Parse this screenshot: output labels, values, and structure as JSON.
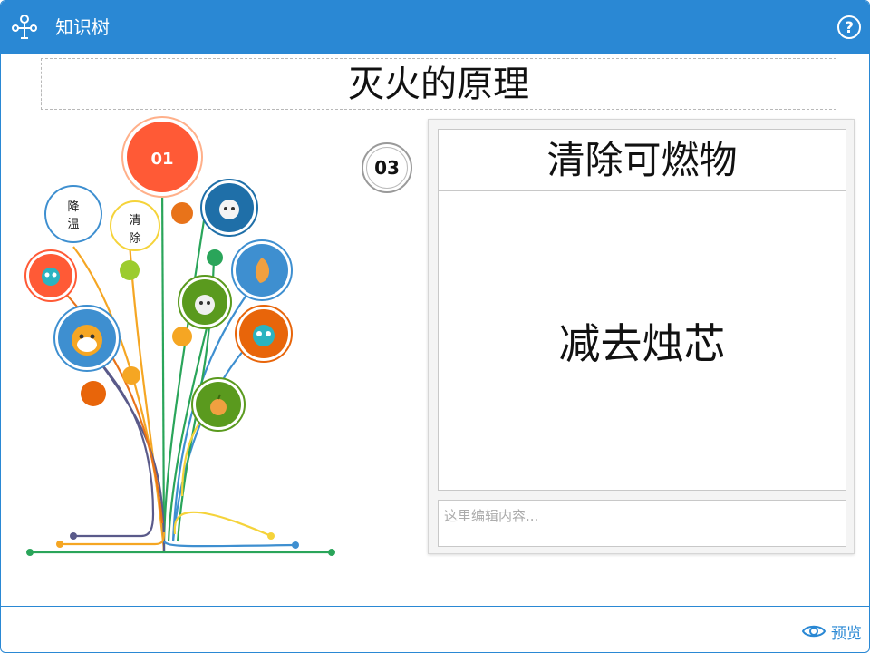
{
  "window": {
    "title": "知识树",
    "help_icon": "help-circle-icon",
    "app_icon": "tree-icon"
  },
  "page": {
    "title": "灭火的原理"
  },
  "tree": {
    "top_node": "01",
    "node_cooling": [
      "降",
      "温"
    ],
    "node_clear": [
      "清",
      "除"
    ]
  },
  "card": {
    "number": "03",
    "heading": "清除可燃物",
    "body": "减去烛芯",
    "edit_placeholder": "这里编辑内容..."
  },
  "footer": {
    "preview_label": "预览",
    "preview_icon": "eye-icon"
  },
  "colors": {
    "accent": "#2a88d4",
    "orange_red": "#ff5a36",
    "orange": "#e8731a",
    "blue": "#3e8fd0",
    "green": "#5a9a1e",
    "lime": "#9ccc2e"
  }
}
